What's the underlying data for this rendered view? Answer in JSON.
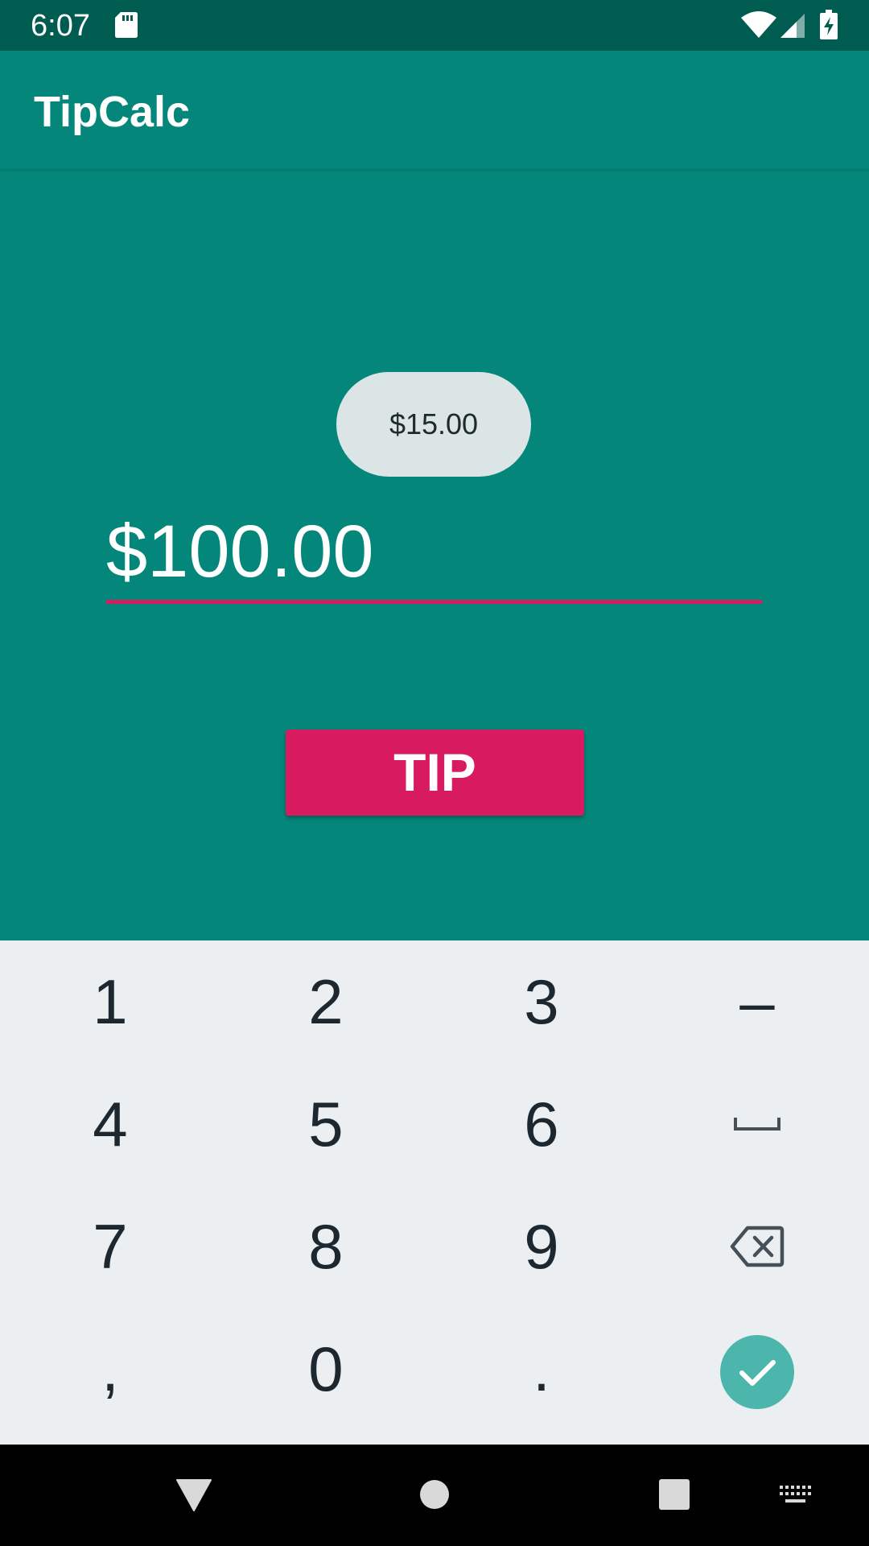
{
  "status_bar": {
    "time": "6:07",
    "icons": [
      "sd-card-icon",
      "wifi-icon",
      "signal-icon",
      "battery-charging-icon"
    ]
  },
  "app_bar": {
    "title": "TipCalc"
  },
  "main": {
    "tip_result": "$15.00",
    "amount_input": {
      "value": "$100.00"
    },
    "tip_button_label": "TIP"
  },
  "keyboard": {
    "keys": [
      "1",
      "2",
      "3",
      "–",
      "4",
      "5",
      "6",
      "7",
      "8",
      "9",
      ",",
      "0",
      "."
    ],
    "special_icons": [
      "space-key-icon",
      "backspace-icon",
      "done-check-icon"
    ]
  },
  "nav_bar": {
    "icons": [
      "back-icon",
      "home-icon",
      "recents-icon",
      "keyboard-switch-icon"
    ]
  },
  "colors": {
    "primary": "#04877a",
    "primary_dark": "#005b51",
    "accent": "#d81b60",
    "chip_bg": "#dce5e5",
    "keyboard_bg": "#eceff1",
    "done_key": "#4db6ac"
  }
}
